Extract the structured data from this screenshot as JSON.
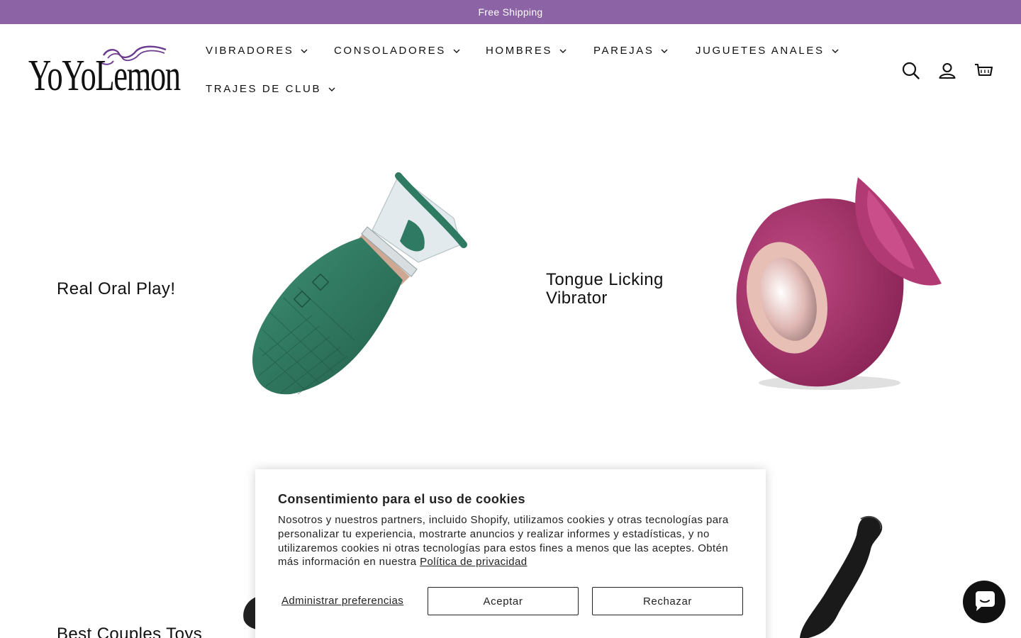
{
  "announcement": {
    "text": "Free Shipping"
  },
  "header": {
    "logo_text": "YoYoLemon",
    "nav": [
      {
        "label": "VIBRADORES"
      },
      {
        "label": "CONSOLADORES"
      },
      {
        "label": "HOMBRES"
      },
      {
        "label": "PAREJAS"
      },
      {
        "label": "JUGUETES ANALES"
      },
      {
        "label": "TRAJES DE CLUB"
      }
    ],
    "icons": [
      "search-icon",
      "account-icon",
      "cart-icon"
    ]
  },
  "promos": [
    {
      "title": "Real Oral Play!"
    },
    {
      "title_line1": "Tongue Licking",
      "title_line2": "Vibrator"
    },
    {
      "title": "Best Couples Toys"
    }
  ],
  "cookie_banner": {
    "title": "Consentimiento para el uso de cookies",
    "body": "Nosotros y nuestros partners, incluido Shopify, utilizamos cookies y otras tecnologías para personalizar tu experiencia, mostrarte anuncios y realizar informes y estadísticas, y no utilizaremos cookies ni otras tecnologías para estos fines a menos que las aceptes. Obtén más información en nuestra ",
    "policy_link": "Política de privacidad",
    "manage_label": "Administrar preferencias",
    "accept_label": "Aceptar",
    "reject_label": "Rechazar"
  },
  "colors": {
    "announcement_bg": "#8c63a5",
    "green_product": "#2f7a62",
    "pink_product": "#a8336a",
    "black_product": "#1a1a1a"
  },
  "chat_widget": {
    "icon": "chat-icon"
  }
}
